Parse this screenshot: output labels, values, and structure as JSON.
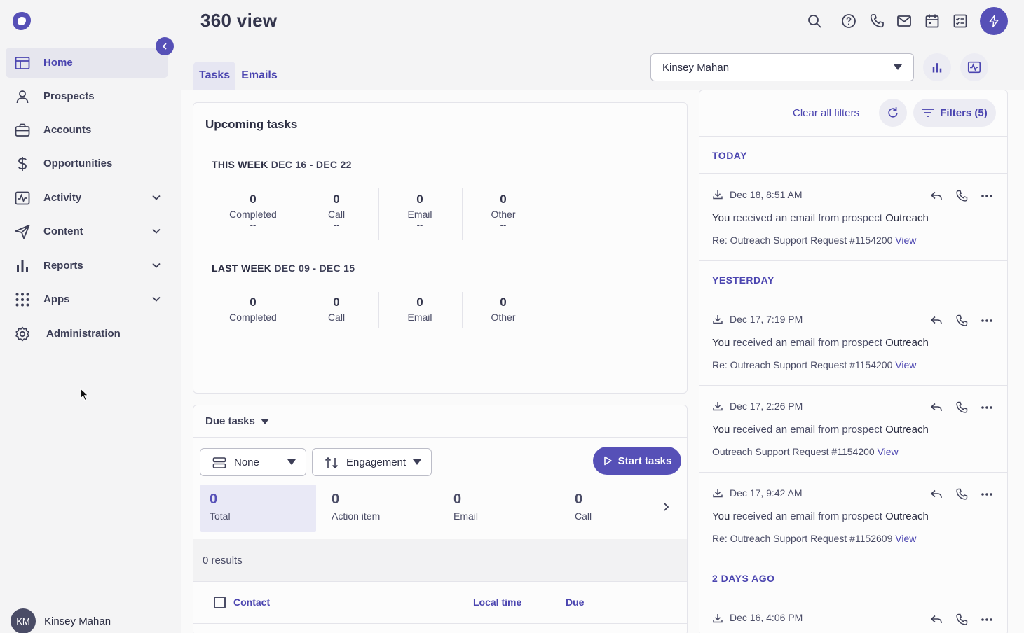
{
  "header": {
    "title": "360 view"
  },
  "sidebar": {
    "items": [
      {
        "label": "Home"
      },
      {
        "label": "Prospects"
      },
      {
        "label": "Accounts"
      },
      {
        "label": "Opportunities"
      },
      {
        "label": "Activity"
      },
      {
        "label": "Content"
      },
      {
        "label": "Reports"
      },
      {
        "label": "Apps"
      },
      {
        "label": "Administration"
      }
    ],
    "user": {
      "initials": "KM",
      "name": "Kinsey Mahan"
    }
  },
  "tabs": [
    {
      "label": "Tasks"
    },
    {
      "label": "Emails"
    }
  ],
  "user_select": {
    "value": "Kinsey Mahan"
  },
  "upcoming": {
    "title": "Upcoming tasks",
    "this_week": {
      "label": "THIS WEEK",
      "range": "DEC 16 - DEC 22",
      "stats": [
        {
          "n": "0",
          "l": "Completed",
          "d": "--"
        },
        {
          "n": "0",
          "l": "Call",
          "d": "--"
        },
        {
          "n": "0",
          "l": "Email",
          "d": "--"
        },
        {
          "n": "0",
          "l": "Other",
          "d": "--"
        }
      ]
    },
    "last_week": {
      "label": "LAST WEEK",
      "range": "DEC 09 - DEC 15",
      "stats": [
        {
          "n": "0",
          "l": "Completed"
        },
        {
          "n": "0",
          "l": "Call"
        },
        {
          "n": "0",
          "l": "Email"
        },
        {
          "n": "0",
          "l": "Other"
        }
      ]
    }
  },
  "due": {
    "title": "Due tasks",
    "group_by": "None",
    "sort_by": "Engagement",
    "start_label": "Start tasks",
    "counts": [
      {
        "n": "0",
        "l": "Total"
      },
      {
        "n": "0",
        "l": "Action item"
      },
      {
        "n": "0",
        "l": "Email"
      },
      {
        "n": "0",
        "l": "Call"
      }
    ],
    "results": "0 results",
    "columns": {
      "contact": "Contact",
      "local_time": "Local time",
      "due": "Due"
    }
  },
  "feed": {
    "clear_label": "Clear all filters",
    "filters_label": "Filters (5)",
    "groups": [
      {
        "label": "TODAY",
        "items": [
          {
            "time": "Dec 18, 8:51 AM",
            "you": "You",
            "msg": "received an email from prospect",
            "who": "Outreach",
            "subject": "Re: Outreach Support Request #1154200",
            "link": "View"
          }
        ]
      },
      {
        "label": "YESTERDAY",
        "items": [
          {
            "time": "Dec 17, 7:19 PM",
            "you": "You",
            "msg": "received an email from prospect",
            "who": "Outreach",
            "subject": "Re: Outreach Support Request #1154200",
            "link": "View"
          },
          {
            "time": "Dec 17, 2:26 PM",
            "you": "You",
            "msg": "received an email from prospect",
            "who": "Outreach",
            "subject": "Outreach Support Request #1154200",
            "link": "View"
          },
          {
            "time": "Dec 17, 9:42 AM",
            "you": "You",
            "msg": "received an email from prospect",
            "who": "Outreach",
            "subject": "Re: Outreach Support Request #1152609",
            "link": "View"
          }
        ]
      },
      {
        "label": "2 DAYS AGO",
        "items": [
          {
            "time": "Dec 16, 4:06 PM"
          }
        ]
      }
    ]
  },
  "colors": {
    "accent": "#5650b7",
    "link": "#4b45b0",
    "text": "#2b2d42"
  }
}
